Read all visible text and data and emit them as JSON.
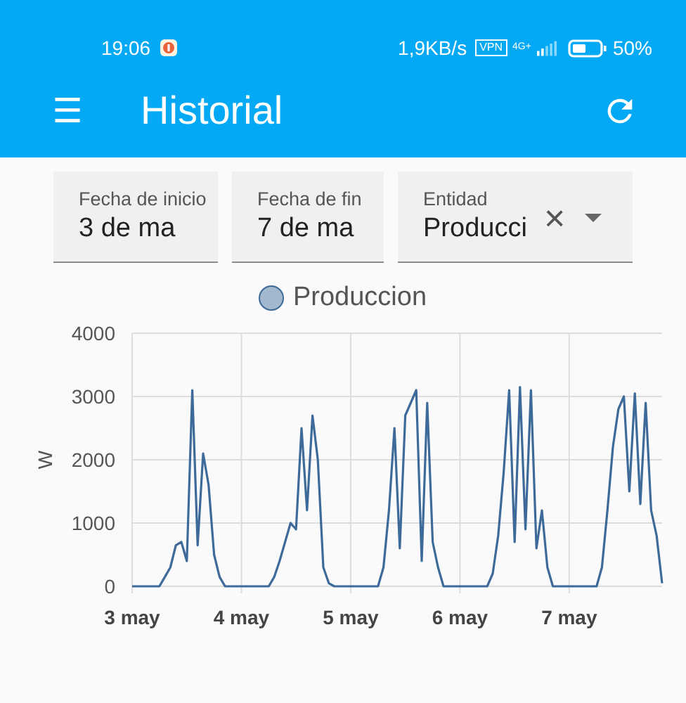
{
  "status_bar": {
    "time": "19:06",
    "speed": "1,9KB/s",
    "vpn": "VPN",
    "network": "4G+",
    "battery": "50%"
  },
  "app_bar": {
    "menu": "☰",
    "title": "Historial"
  },
  "filters": [
    {
      "kind": "date",
      "label": "Fecha de inicio",
      "value": "3 de ma"
    },
    {
      "kind": "date",
      "label": "Fecha de fin",
      "value": "7 de ma"
    },
    {
      "kind": "select",
      "label": "Entidad",
      "value": "Producci",
      "clear": "×"
    }
  ],
  "chart_data": {
    "type": "line",
    "grid": true,
    "ylabel": "W",
    "ylim": [
      0,
      4000
    ],
    "yticks": [
      0,
      1000,
      2000,
      3000,
      4000
    ],
    "categories": [
      "3 may",
      null,
      null,
      null,
      null,
      null,
      null,
      null,
      null,
      null,
      null,
      null,
      null,
      null,
      null,
      null,
      null,
      null,
      null,
      null,
      "4 may",
      null,
      null,
      null,
      null,
      null,
      null,
      null,
      null,
      null,
      null,
      null,
      null,
      null,
      null,
      null,
      null,
      null,
      null,
      null,
      "5 may",
      null,
      null,
      null,
      null,
      null,
      null,
      null,
      null,
      null,
      null,
      null,
      null,
      null,
      null,
      null,
      null,
      null,
      null,
      null,
      "6 may",
      null,
      null,
      null,
      null,
      null,
      null,
      null,
      null,
      null,
      null,
      null,
      null,
      null,
      null,
      null,
      null,
      null,
      null,
      null,
      "7 may",
      null,
      null,
      null,
      null,
      null,
      null,
      null,
      null,
      null,
      null,
      null,
      null,
      null,
      null,
      null,
      null,
      null
    ],
    "series": [
      {
        "name": "Produccion",
        "color": "#3d6a99",
        "values": [
          0,
          0,
          0,
          0,
          0,
          0,
          150,
          300,
          650,
          700,
          400,
          3100,
          650,
          2100,
          1600,
          500,
          150,
          0,
          0,
          0,
          0,
          0,
          0,
          0,
          0,
          0,
          150,
          400,
          700,
          1000,
          900,
          2500,
          1200,
          2700,
          2000,
          300,
          50,
          0,
          0,
          0,
          0,
          0,
          0,
          0,
          0,
          0,
          300,
          1200,
          2500,
          600,
          2700,
          2900,
          3100,
          400,
          2900,
          700,
          300,
          0,
          0,
          0,
          0,
          0,
          0,
          0,
          0,
          0,
          200,
          800,
          1800,
          3100,
          700,
          3150,
          900,
          3100,
          600,
          1200,
          300,
          0,
          0,
          0,
          0,
          0,
          0,
          0,
          0,
          0,
          300,
          1200,
          2200,
          2800,
          3000,
          1500,
          3050,
          1300,
          2900,
          1200,
          800,
          50
        ]
      }
    ]
  }
}
